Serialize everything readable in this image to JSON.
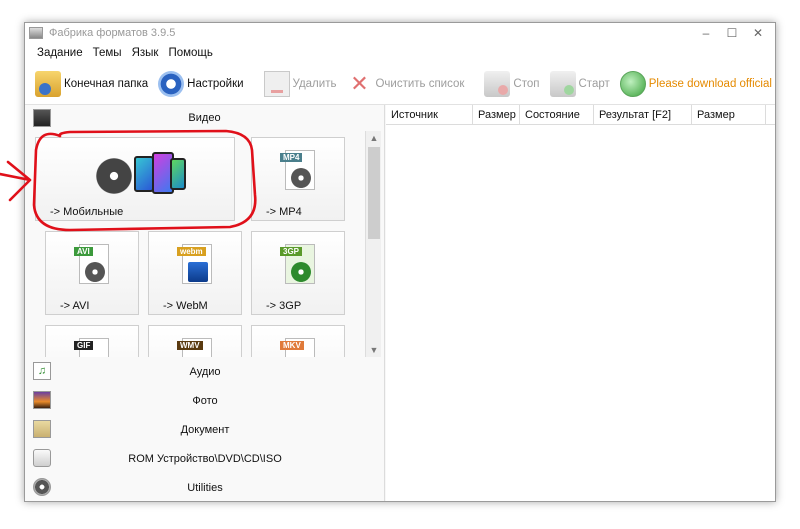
{
  "window": {
    "title": "Фабрика форматов 3.9.5",
    "controls": {
      "minimize": "–",
      "maximize": "☐",
      "close": "✕"
    }
  },
  "menu": [
    "Задание",
    "Темы",
    "Язык",
    "Помощь"
  ],
  "toolbar": {
    "output_folder": "Конечная папка",
    "settings": "Настройки",
    "delete": "Удалить",
    "clear_list": "Очистить список",
    "stop": "Стоп",
    "start": "Старт",
    "download": "Please download official v"
  },
  "categories": {
    "video": "Видео",
    "audio": "Аудио",
    "photo": "Фото",
    "document": "Документ",
    "rom": "ROM Устройство\\DVD\\CD\\ISO",
    "utilities": "Utilities"
  },
  "tiles": {
    "mobile": "-> Мобильные",
    "mp4": "-> MP4",
    "mp4_tag": "MP4",
    "avi": "-> AVI",
    "avi_tag": "AVI",
    "webm": "-> WebM",
    "webm_tag": "webm",
    "gp3": "-> 3GP",
    "gp3_tag": "3GP",
    "gif_tag": "GIF",
    "wmv_tag": "WMV",
    "mkv_tag": "MKV"
  },
  "table_columns": [
    "Источник",
    "Размер",
    "Состояние",
    "Результат [F2]",
    "Размер"
  ],
  "colors": {
    "annotation": "#e0101a",
    "download_link": "#e58a00",
    "disabled_text": "#9d9d9d"
  }
}
